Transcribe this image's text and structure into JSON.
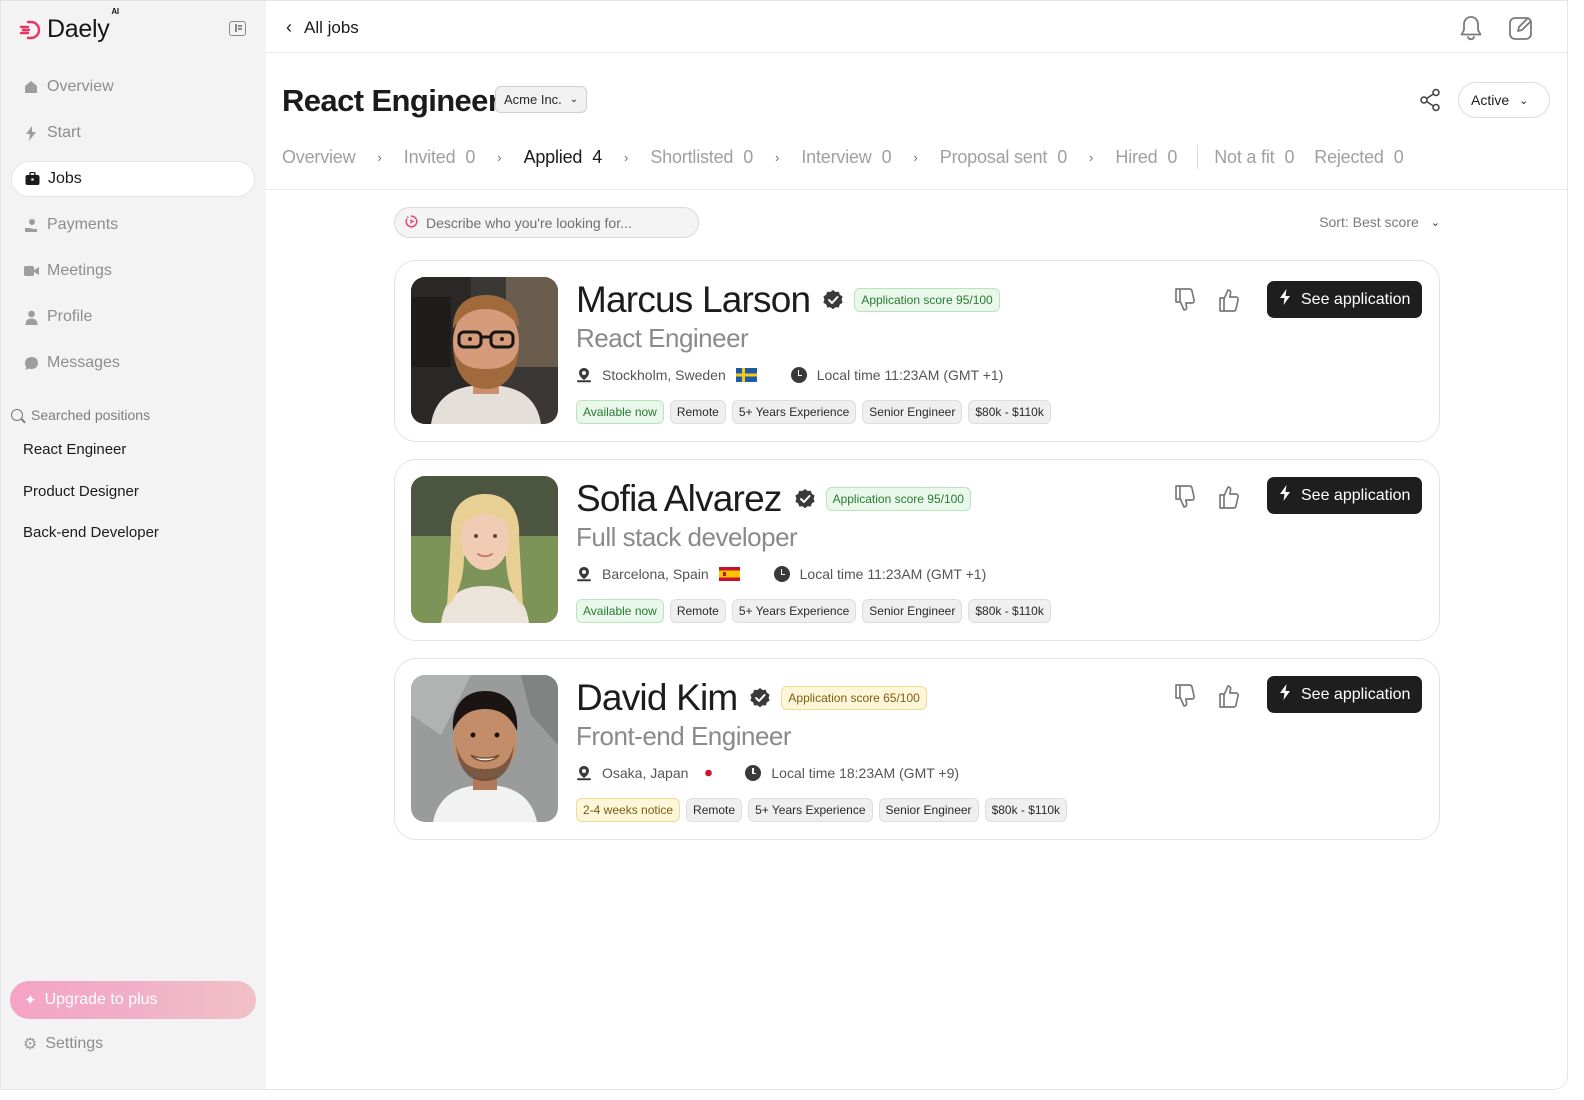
{
  "sidebar": {
    "brand": "Daely",
    "brand_sup": "AI",
    "nav": [
      {
        "label": "Overview",
        "icon": "home-icon"
      },
      {
        "label": "Start",
        "icon": "bolt-icon"
      },
      {
        "label": "Jobs",
        "icon": "briefcase-icon",
        "active": true
      },
      {
        "label": "Payments",
        "icon": "hand-coin-icon"
      },
      {
        "label": "Meetings",
        "icon": "video-icon"
      },
      {
        "label": "Profile",
        "icon": "person-icon"
      },
      {
        "label": "Messages",
        "icon": "chat-icon"
      }
    ],
    "searched_label": "Searched positions",
    "positions": [
      "React Engineer",
      "Product Designer",
      "Back-end Developer"
    ],
    "upgrade_label": "Upgrade to plus",
    "settings_label": "Settings"
  },
  "topbar": {
    "back_label": "All jobs"
  },
  "job": {
    "title": "React Engineer",
    "company": "Acme Inc.",
    "status": "Active"
  },
  "tabs": [
    {
      "label": "Overview",
      "count": ""
    },
    {
      "label": "Invited",
      "count": "0"
    },
    {
      "label": "Applied",
      "count": "4",
      "active": true
    },
    {
      "label": "Shortlisted",
      "count": "0"
    },
    {
      "label": "Interview",
      "count": "0"
    },
    {
      "label": "Proposal sent",
      "count": "0"
    },
    {
      "label": "Hired",
      "count": "0"
    },
    {
      "label": "Not a fit",
      "count": "0"
    },
    {
      "label": "Rejected",
      "count": "0"
    }
  ],
  "search": {
    "placeholder": "Describe who you're looking for..."
  },
  "sort_label": "Sort: Best score",
  "candidates": [
    {
      "name": "Marcus Larson",
      "score": "Application score 95/100",
      "score_level": "green",
      "role": "React Engineer",
      "location": "Stockholm, Sweden",
      "flag": "sweden",
      "local_time": "Local time 11:23AM (GMT +1)",
      "availability": "Available now",
      "availability_level": "green",
      "tags": [
        "Remote",
        "5+ Years Experience",
        "Senior Engineer",
        "$80k - $110k"
      ],
      "button": "See application"
    },
    {
      "name": "Sofia Alvarez",
      "score": "Application score 95/100",
      "score_level": "green",
      "role": "Full stack developer",
      "location": "Barcelona, Spain",
      "flag": "spain",
      "local_time": "Local time 11:23AM (GMT +1)",
      "availability": "Available now",
      "availability_level": "green",
      "tags": [
        "Remote",
        "5+ Years Experience",
        "Senior Engineer",
        "$80k - $110k"
      ],
      "button": "See application"
    },
    {
      "name": "David Kim",
      "score": "Application score 65/100",
      "score_level": "yellow",
      "role": "Front-end Engineer",
      "location": "Osaka, Japan",
      "flag": "japan",
      "local_time": "Local time 18:23AM (GMT +9)",
      "availability": "2-4 weeks notice",
      "availability_level": "yellow",
      "tags": [
        "Remote",
        "5+ Years Experience",
        "Senior Engineer",
        "$80k - $110k"
      ],
      "button": "See application"
    }
  ]
}
